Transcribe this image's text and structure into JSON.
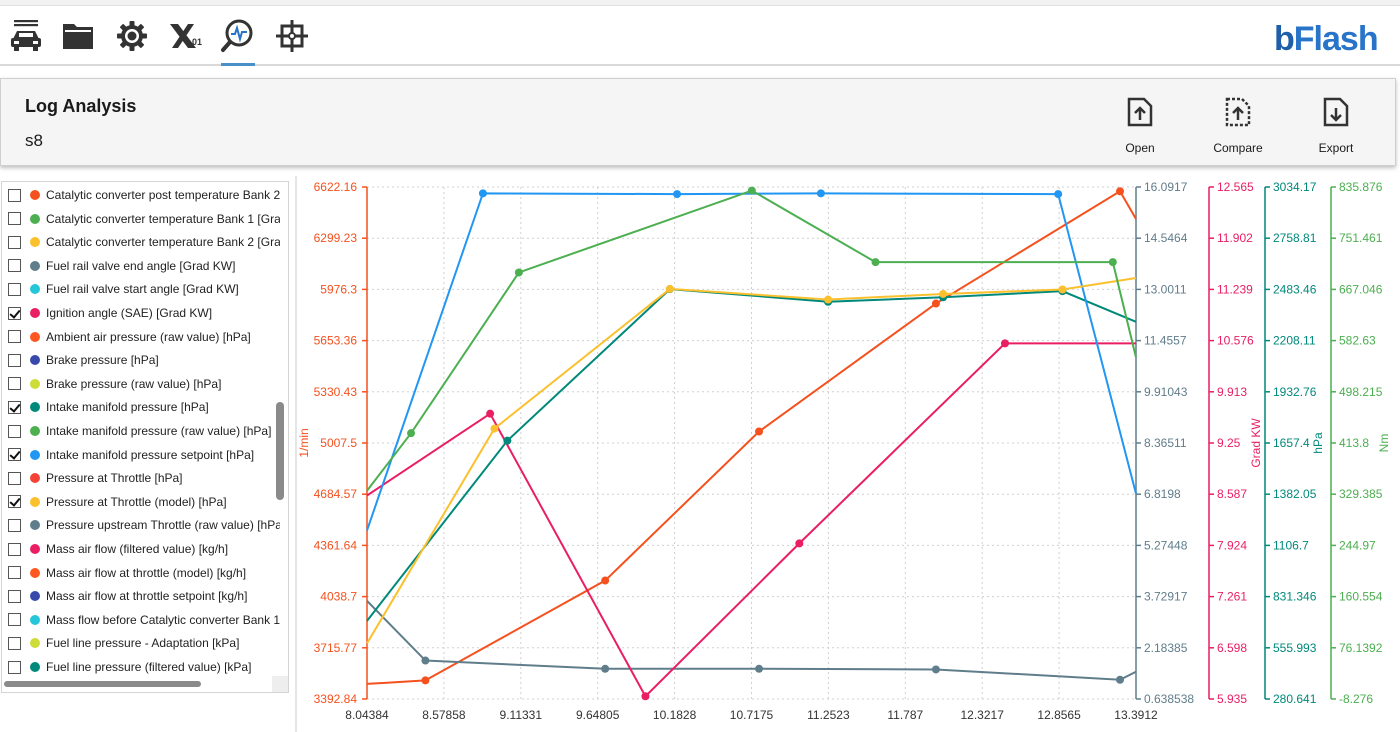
{
  "toolbar": {
    "icons": [
      "car-icon",
      "folder-icon",
      "gear-icon",
      "dtc-icon",
      "log-analysis-icon",
      "crosshair-icon"
    ],
    "dtc_label": "01",
    "logo_text": "bFlash",
    "accent": "#2874c8"
  },
  "header": {
    "title": "Log Analysis",
    "subtitle": "s8",
    "actions": {
      "open": "Open",
      "compare": "Compare",
      "export": "Export"
    }
  },
  "signals": [
    {
      "label": "Catalytic converter post temperature Bank 2",
      "color": "#f4511e",
      "checked": false
    },
    {
      "label": "Catalytic converter temperature Bank 1 [Gra",
      "color": "#4caf50",
      "checked": false
    },
    {
      "label": "Catalytic converter temperature Bank 2 [Gra",
      "color": "#fbc02d",
      "checked": false
    },
    {
      "label": "Fuel rail valve end angle [Grad KW]",
      "color": "#607d8b",
      "checked": false
    },
    {
      "label": "Fuel rail valve start angle [Grad KW]",
      "color": "#26c6da",
      "checked": false
    },
    {
      "label": "Ignition angle (SAE) [Grad KW]",
      "color": "#e91e63",
      "checked": true
    },
    {
      "label": "Ambient air pressure (raw value) [hPa]",
      "color": "#ff5722",
      "checked": false
    },
    {
      "label": "Brake pressure [hPa]",
      "color": "#3949ab",
      "checked": false
    },
    {
      "label": "Brake pressure (raw value) [hPa]",
      "color": "#cddc39",
      "checked": false
    },
    {
      "label": "Intake manifold pressure [hPa]",
      "color": "#00897b",
      "checked": true
    },
    {
      "label": "Intake manifold pressure (raw value) [hPa]",
      "color": "#4caf50",
      "checked": false
    },
    {
      "label": "Intake manifold pressure setpoint [hPa]",
      "color": "#2196f3",
      "checked": true
    },
    {
      "label": "Pressure at Throttle [hPa]",
      "color": "#f44336",
      "checked": false
    },
    {
      "label": "Pressure at Throttle (model) [hPa]",
      "color": "#fbc02d",
      "checked": true
    },
    {
      "label": "Pressure upstream Throttle (raw value) [hPa",
      "color": "#607d8b",
      "checked": false
    },
    {
      "label": "Mass air flow (filtered value) [kg/h]",
      "color": "#e91e63",
      "checked": false
    },
    {
      "label": "Mass air flow at throttle (model) [kg/h]",
      "color": "#ff5722",
      "checked": false
    },
    {
      "label": "Mass air flow at throttle setpoint [kg/h]",
      "color": "#3949ab",
      "checked": false
    },
    {
      "label": "Mass flow before Catalytic converter Bank 1",
      "color": "#26c6da",
      "checked": false
    },
    {
      "label": "Fuel line pressure - Adaptation [kPa]",
      "color": "#cddc39",
      "checked": false
    },
    {
      "label": "Fuel line pressure (filtered value) [kPa]",
      "color": "#00897b",
      "checked": false
    }
  ],
  "chart_data": {
    "type": "line",
    "grid": true,
    "x_ticks": [
      "8.04384",
      "8.57858",
      "9.11331",
      "9.64805",
      "10.1828",
      "10.7175",
      "11.2523",
      "11.787",
      "12.3217",
      "12.8565",
      "13.3912"
    ],
    "xlim": [
      8.04384,
      13.3912
    ],
    "axes": [
      {
        "id": "rpm",
        "label": "1/min",
        "color": "#f4511e",
        "side": "left",
        "ylim": [
          3392.84,
          6622.16
        ],
        "ticks": [
          "6622.16",
          "6299.23",
          "5976.3",
          "5653.36",
          "5330.43",
          "5007.5",
          "4684.57",
          "4361.64",
          "4038.7",
          "3715.77",
          "3392.84"
        ]
      },
      {
        "id": "unnamed",
        "label": "",
        "color": "#607d8b",
        "side": "right",
        "ylim": [
          0.638538,
          16.0917
        ],
        "ticks": [
          "16.0917",
          "14.5464",
          "13.0011",
          "11.4557",
          "9.91043",
          "8.36511",
          "6.8198",
          "5.27448",
          "3.72917",
          "2.18385",
          "0.638538"
        ]
      },
      {
        "id": "grad",
        "label": "Grad KW",
        "color": "#e91e63",
        "side": "right",
        "ylim": [
          5.935,
          12.565
        ],
        "ticks": [
          "12.565",
          "11.902",
          "11.239",
          "10.576",
          "9.913",
          "9.25",
          "8.587",
          "7.924",
          "7.261",
          "6.598",
          "5.935"
        ]
      },
      {
        "id": "hpa",
        "label": "hPa",
        "color": "#00897b",
        "side": "right",
        "ylim": [
          280.641,
          3034.17
        ],
        "ticks": [
          "3034.17",
          "2758.81",
          "2483.46",
          "2208.11",
          "1932.76",
          "1657.4",
          "1382.05",
          "1106.7",
          "831.346",
          "555.993",
          "280.641"
        ]
      },
      {
        "id": "nm",
        "label": "Nm",
        "color": "#4caf50",
        "side": "right",
        "ylim": [
          -8.276,
          835.876
        ],
        "ticks": [
          "835.876",
          "751.461",
          "667.046",
          "582.63",
          "498.215",
          "413.8",
          "329.385",
          "244.97",
          "160.554",
          "76.1392",
          "-8.276"
        ]
      }
    ],
    "series": [
      {
        "axis": "rpm",
        "color": "#f4511e",
        "x": [
          8.04384,
          8.45,
          9.7,
          10.77,
          12.0,
          13.28,
          13.3912
        ],
        "y": [
          3488,
          3510,
          4140,
          5080,
          5887,
          6595,
          6420
        ]
      },
      {
        "axis": "unnamed",
        "color": "#607d8b",
        "x": [
          8.04384,
          8.45,
          9.7,
          10.77,
          12.0,
          13.28,
          13.3912
        ],
        "y": [
          3.6,
          1.8,
          1.55,
          1.55,
          1.53,
          1.22,
          1.46
        ]
      },
      {
        "axis": "grad",
        "color": "#e91e63",
        "x": [
          8.04384,
          8.9,
          9.98,
          11.05,
          12.48,
          13.3912
        ],
        "y": [
          8.57,
          9.63,
          5.97,
          7.95,
          10.54,
          10.54
        ]
      },
      {
        "axis": "hpa",
        "color": "#00897b",
        "x": [
          8.04384,
          9.02,
          10.15,
          11.25,
          12.05,
          12.88,
          13.3912
        ],
        "y": [
          701,
          1670,
          2485,
          2417,
          2441,
          2474,
          2309
        ]
      },
      {
        "axis": "hpa",
        "color": "#2196f3",
        "x": [
          8.04384,
          8.85,
          10.2,
          11.2,
          12.85,
          13.3912
        ],
        "y": [
          1187,
          3000,
          2996,
          3000,
          2996,
          1385
        ]
      },
      {
        "axis": "hpa",
        "color": "#fbc02d",
        "x": [
          8.04384,
          8.93,
          10.15,
          11.25,
          12.05,
          12.88,
          13.3912
        ],
        "y": [
          580,
          1735,
          2486,
          2429,
          2459,
          2483,
          2545
        ]
      },
      {
        "axis": "nm",
        "color": "#4caf50",
        "x": [
          8.04384,
          8.35,
          9.1,
          10.72,
          11.58,
          13.23,
          13.3912
        ],
        "y": [
          335,
          430,
          695,
          830,
          712,
          712,
          555
        ]
      }
    ]
  }
}
